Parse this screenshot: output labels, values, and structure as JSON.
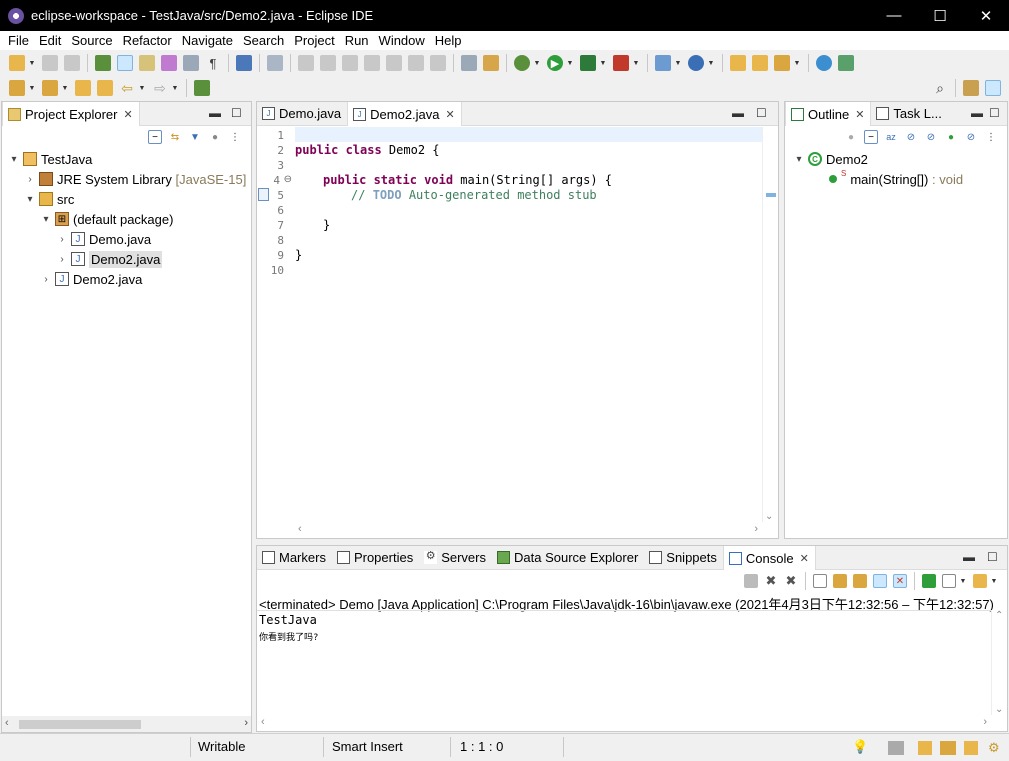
{
  "window": {
    "title": "eclipse-workspace - TestJava/src/Demo2.java - Eclipse IDE",
    "minimize_glyph": "—",
    "maximize_glyph": "☐",
    "close_glyph": "✕"
  },
  "menu": [
    "File",
    "Edit",
    "Source",
    "Refactor",
    "Navigate",
    "Search",
    "Project",
    "Run",
    "Window",
    "Help"
  ],
  "colors": {
    "keyword": "#7f0055",
    "comment": "#3f7f5f",
    "todo": "#7f9fbf",
    "run_green": "#2e9e3a",
    "accent_selected": "#cce8ff"
  },
  "project_explorer": {
    "tab_label": "Project Explorer",
    "tree": [
      {
        "label": "TestJava",
        "suffix": "",
        "icon": "java-project-icon",
        "level": 0,
        "expanded": true
      },
      {
        "label": "JRE System Library",
        "suffix": "[JavaSE-15]",
        "icon": "library-icon",
        "level": 1,
        "expanded": false
      },
      {
        "label": "src",
        "suffix": "",
        "icon": "source-folder-icon",
        "level": 1,
        "expanded": true
      },
      {
        "label": "(default package)",
        "suffix": "",
        "icon": "package-icon",
        "level": 2,
        "expanded": true
      },
      {
        "label": "Demo.java",
        "suffix": "",
        "icon": "java-file-icon",
        "level": 3,
        "expanded": false
      },
      {
        "label": "Demo2.java",
        "suffix": "",
        "icon": "java-file-icon",
        "level": 3,
        "expanded": false,
        "selected": true
      },
      {
        "label": "Demo2.java",
        "suffix": "",
        "icon": "java-file-icon",
        "level": 2,
        "expanded": false
      }
    ]
  },
  "editor": {
    "tabs": [
      {
        "label": "Demo.java",
        "active": false
      },
      {
        "label": "Demo2.java",
        "active": true
      }
    ],
    "line_numbers": [
      "1",
      "2",
      "3",
      "4",
      "5",
      "6",
      "7",
      "8",
      "9",
      "10"
    ],
    "lines": {
      "l2_kw": "public class",
      "l2_rest": " Demo2 {",
      "l4_kw": "public static void",
      "l4_rest": " main(String[] args) {",
      "l5_comment_start": "// ",
      "l5_todo": "TODO",
      "l5_comment_rest": " Auto-generated method stub",
      "l7": "}",
      "l9": "}"
    },
    "fold_marker": "⊖"
  },
  "outline": {
    "tabs": [
      {
        "label": "Outline",
        "active": true
      },
      {
        "label": "Task L...",
        "active": false
      }
    ],
    "tree": [
      {
        "label": "Demo2",
        "suffix": ""
      },
      {
        "label": "main(String[])",
        "suffix": ": void",
        "modifier": "S"
      }
    ]
  },
  "bottom_panel": {
    "tabs": [
      {
        "label": "Markers",
        "active": false
      },
      {
        "label": "Properties",
        "active": false
      },
      {
        "label": "Servers",
        "active": false
      },
      {
        "label": "Data Source Explorer",
        "active": false
      },
      {
        "label": "Snippets",
        "active": false
      },
      {
        "label": "Console",
        "active": true
      }
    ],
    "console": {
      "header": "<terminated> Demo [Java Application] C:\\Program Files\\Java\\jdk-16\\bin\\javaw.exe  (2021年4月3日下午12:32:56 – 下午12:32:57)",
      "output": [
        "TestJava",
        "你看到我了吗?"
      ]
    }
  },
  "status": {
    "writable": "Writable",
    "insert_mode": "Smart Insert",
    "position": "1 : 1 : 0"
  }
}
